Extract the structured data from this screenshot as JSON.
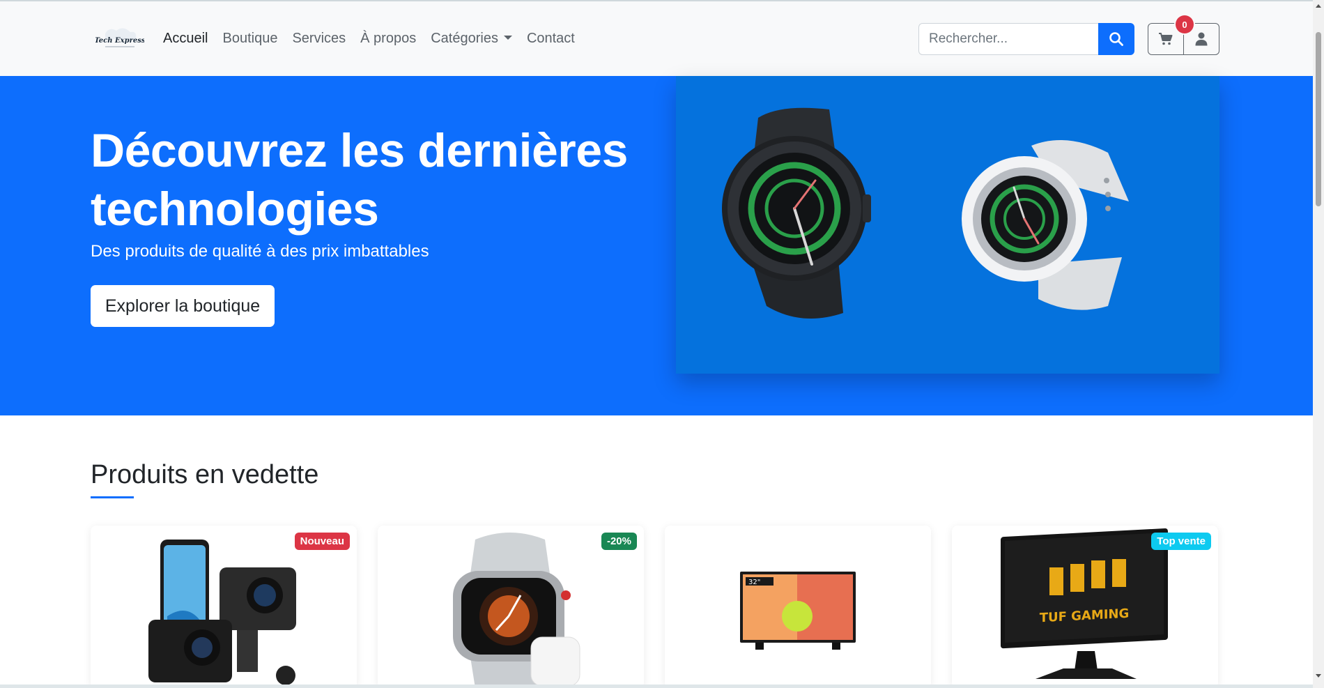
{
  "brand": {
    "logo_text": "Tech Express"
  },
  "nav": {
    "items": [
      {
        "label": "Accueil",
        "active": true
      },
      {
        "label": "Boutique"
      },
      {
        "label": "Services"
      },
      {
        "label": "À propos"
      },
      {
        "label": "Catégories"
      },
      {
        "label": "Contact"
      }
    ]
  },
  "search": {
    "placeholder": "Rechercher..."
  },
  "cart": {
    "count": "0"
  },
  "hero": {
    "title": "Découvrez les dernières technologies",
    "subtitle": "Des produits de qualité à des prix imbattables",
    "cta": "Explorer la boutique"
  },
  "featured": {
    "title": "Produits en vedette",
    "products": [
      {
        "badge": "Nouveau",
        "badge_color": "#dc3545",
        "icon": "action-camera"
      },
      {
        "badge": "-20%",
        "badge_color": "#198754",
        "icon": "smartwatch"
      },
      {
        "badge": "",
        "badge_color": "",
        "icon": "television"
      },
      {
        "badge": "Top vente",
        "badge_color": "#0dcaf0",
        "icon": "gaming-monitor"
      }
    ]
  },
  "colors": {
    "primary": "#0d6efd",
    "hero_image_bg": "#0572dd"
  }
}
